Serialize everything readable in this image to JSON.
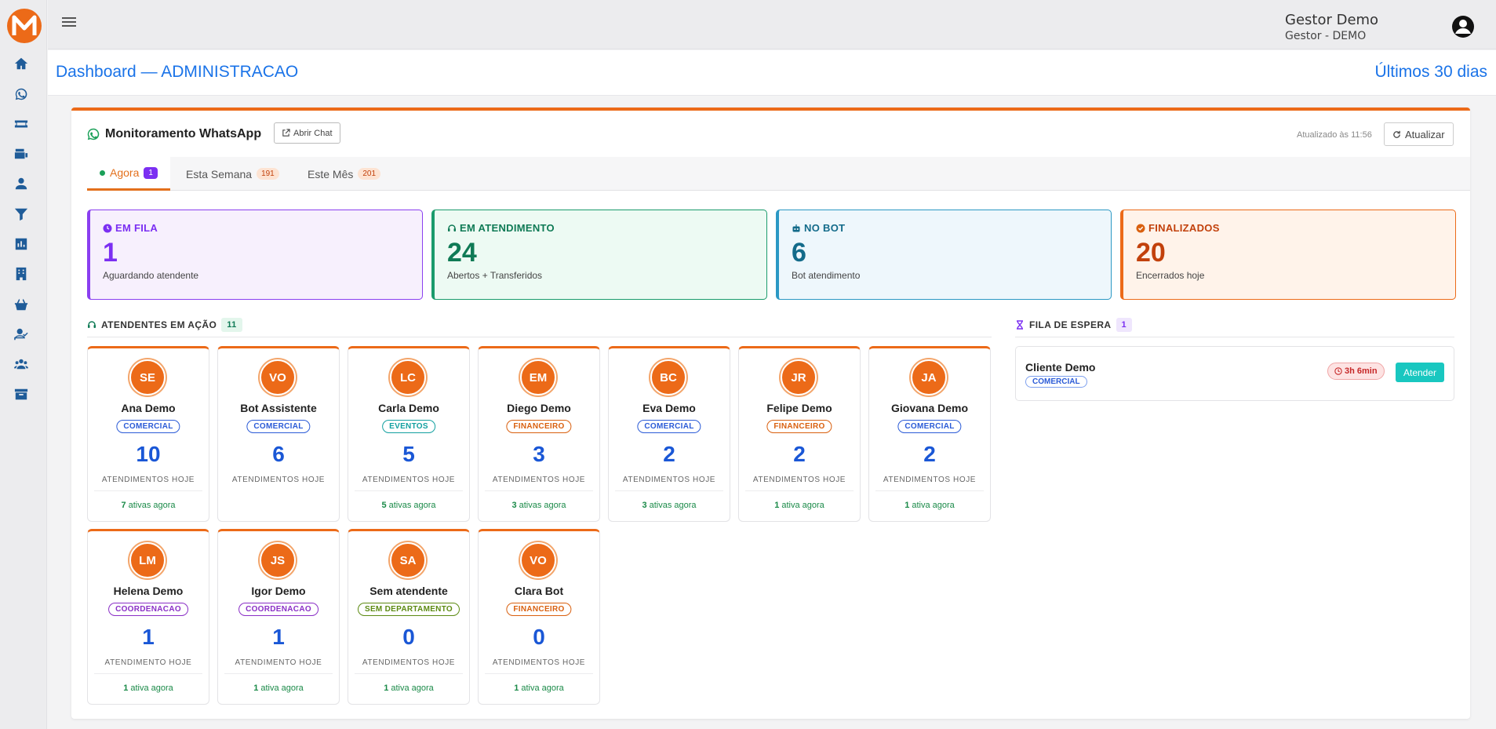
{
  "user": {
    "name": "Gestor Demo",
    "role": "Gestor - DEMO"
  },
  "header": {
    "title": "Dashboard — ADMINISTRACAO",
    "period": "Últimos 30 dias"
  },
  "sidebar": {
    "icons": [
      "home-icon",
      "whatsapp-icon",
      "ticket-icon",
      "mail-inbox-icon",
      "user-icon",
      "filter-icon",
      "chart-icon",
      "building-icon",
      "basket-icon",
      "user-check-icon",
      "users-icon",
      "archive-icon"
    ]
  },
  "monitor": {
    "title": "Monitoramento WhatsApp",
    "open_chat_label": "Abrir Chat",
    "updated_text": "Atualizado às 11:56",
    "refresh_label": "Atualizar",
    "tabs": [
      {
        "label": "Agora",
        "badge": "1"
      },
      {
        "label": "Esta Semana",
        "badge": "191"
      },
      {
        "label": "Este Mês",
        "badge": "201"
      }
    ]
  },
  "stats": [
    {
      "label": "EM FILA",
      "value": "1",
      "sub": "Aguardando atendente",
      "color": "#7b2ff2"
    },
    {
      "label": "EM ATENDIMENTO",
      "value": "24",
      "sub": "Abertos + Transferidos",
      "color": "#0f7a55"
    },
    {
      "label": "NO BOT",
      "value": "6",
      "sub": "Bot atendimento",
      "color": "#136b8a"
    },
    {
      "label": "FINALIZADOS",
      "value": "20",
      "sub": "Encerrados hoje",
      "color": "#c2410c"
    }
  ],
  "agents_section": {
    "title": "ATENDENTES EM AÇÃO",
    "count": "11"
  },
  "agents": [
    {
      "initials": "SE",
      "name": "Ana Demo",
      "dept": "COMERCIAL",
      "count": "10",
      "label": "ATENDIMENTOS HOJE",
      "active_num": "7",
      "active_text": "ativas agora"
    },
    {
      "initials": "VO",
      "name": "Bot Assistente",
      "dept": "COMERCIAL",
      "count": "6",
      "label": "ATENDIMENTOS HOJE",
      "active_num": "",
      "active_text": ""
    },
    {
      "initials": "LC",
      "name": "Carla Demo",
      "dept": "EVENTOS",
      "count": "5",
      "label": "ATENDIMENTOS HOJE",
      "active_num": "5",
      "active_text": "ativas agora"
    },
    {
      "initials": "EM",
      "name": "Diego Demo",
      "dept": "FINANCEIRO",
      "count": "3",
      "label": "ATENDIMENTOS HOJE",
      "active_num": "3",
      "active_text": "ativas agora"
    },
    {
      "initials": "BC",
      "name": "Eva Demo",
      "dept": "COMERCIAL",
      "count": "2",
      "label": "ATENDIMENTOS HOJE",
      "active_num": "3",
      "active_text": "ativas agora"
    },
    {
      "initials": "JR",
      "name": "Felipe Demo",
      "dept": "FINANCEIRO",
      "count": "2",
      "label": "ATENDIMENTOS HOJE",
      "active_num": "1",
      "active_text": "ativa agora"
    },
    {
      "initials": "JA",
      "name": "Giovana Demo",
      "dept": "COMERCIAL",
      "count": "2",
      "label": "ATENDIMENTOS HOJE",
      "active_num": "1",
      "active_text": "ativa agora"
    },
    {
      "initials": "LM",
      "name": "Helena Demo",
      "dept": "COORDENACAO",
      "count": "1",
      "label": "ATENDIMENTO HOJE",
      "active_num": "1",
      "active_text": "ativa agora"
    },
    {
      "initials": "JS",
      "name": "Igor Demo",
      "dept": "COORDENACAO",
      "count": "1",
      "label": "ATENDIMENTO HOJE",
      "active_num": "1",
      "active_text": "ativa agora"
    },
    {
      "initials": "SA",
      "name": "Sem atendente",
      "dept": "SEM DEPARTAMENTO",
      "count": "0",
      "label": "ATENDIMENTOS HOJE",
      "active_num": "1",
      "active_text": "ativa agora"
    },
    {
      "initials": "VO",
      "name": "Clara Bot",
      "dept": "FINANCEIRO",
      "count": "0",
      "label": "ATENDIMENTOS HOJE",
      "active_num": "1",
      "active_text": "ativa agora"
    }
  ],
  "queue_section": {
    "title": "FILA DE ESPERA",
    "count": "1"
  },
  "queue": [
    {
      "name": "Cliente Demo",
      "dept": "COMERCIAL",
      "wait": "3h 6min",
      "action": "Atender"
    }
  ],
  "dept_colors": {
    "COMERCIAL": "#2b5bd7",
    "EVENTOS": "#12a0a0",
    "FINANCEIRO": "#d9600f",
    "COORDENACAO": "#8a2fc6",
    "SEM DEPARTAMENTO": "#5c8a12"
  }
}
